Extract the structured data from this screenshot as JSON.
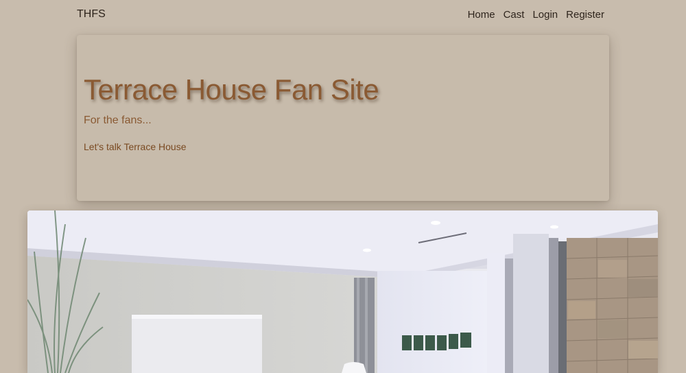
{
  "navbar": {
    "brand": "THFS",
    "links": [
      {
        "label": "Home"
      },
      {
        "label": "Cast"
      },
      {
        "label": "Login"
      },
      {
        "label": "Register"
      }
    ]
  },
  "hero": {
    "title": "Terrace House Fan Site",
    "subtitle": "For the fans...",
    "tagline": "Let's talk Terrace House"
  },
  "colors": {
    "page_background": "#c8bcad",
    "hero_text": "#8a5a33",
    "nav_text": "#2e241c"
  }
}
